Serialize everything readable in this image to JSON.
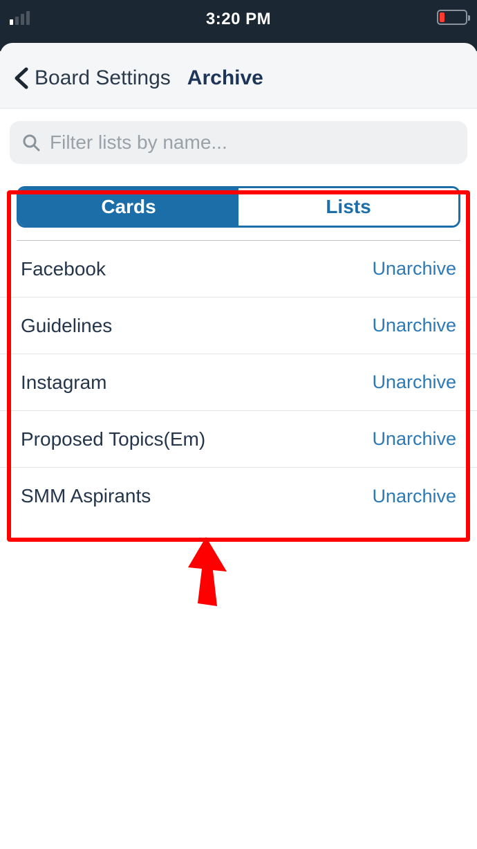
{
  "status": {
    "time": "3:20 PM"
  },
  "nav": {
    "back_label": "Board Settings",
    "title": "Archive"
  },
  "search": {
    "placeholder": "Filter lists by name..."
  },
  "segmented": {
    "cards_label": "Cards",
    "lists_label": "Lists",
    "active": "lists"
  },
  "list_action_label": "Unarchive",
  "items": [
    {
      "label": "Facebook"
    },
    {
      "label": "Guidelines"
    },
    {
      "label": "Instagram"
    },
    {
      "label": "Proposed Topics(Em)"
    },
    {
      "label": "SMM Aspirants"
    }
  ]
}
